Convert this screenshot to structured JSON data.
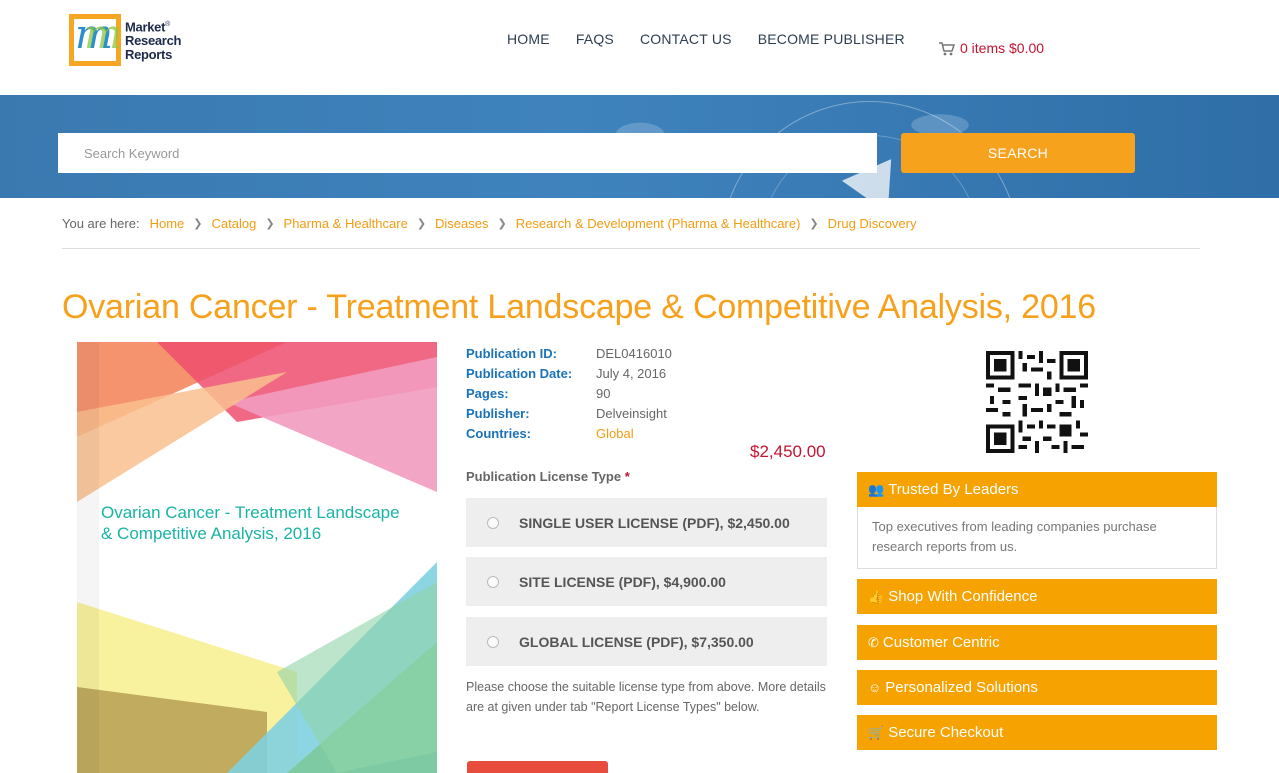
{
  "header": {
    "logo": {
      "line1": "Market",
      "line2": "Research",
      "line3": "Reports",
      "reg": "®"
    },
    "nav": [
      "HOME",
      "FAQS",
      "CONTACT US",
      "BECOME PUBLISHER"
    ],
    "cart": "0 items $0.00"
  },
  "search": {
    "placeholder": "Search Keyword",
    "button": "SEARCH"
  },
  "breadcrumb": {
    "label": "You are here:",
    "items": [
      "Home",
      "Catalog",
      "Pharma & Healthcare",
      "Diseases",
      "Research & Development (Pharma & Healthcare)",
      "Drug Discovery"
    ]
  },
  "title": "Ovarian Cancer - Treatment Landscape & Competitive Analysis, 2016",
  "cover_title": "Ovarian Cancer - Treatment Landscape & Competitive Analysis, 2016",
  "meta": [
    {
      "key": "Publication ID:",
      "value": "DEL0416010"
    },
    {
      "key": "Publication Date:",
      "value": "July 4, 2016"
    },
    {
      "key": "Pages:",
      "value": "90"
    },
    {
      "key": "Publisher:",
      "value": "Delveinsight"
    },
    {
      "key": "Countries:",
      "value": "Global"
    }
  ],
  "price": "$2,450.00",
  "license": {
    "label": "Publication License Type",
    "required": "*",
    "options": [
      "SINGLE USER LICENSE (PDF), $2,450.00",
      "SITE LICENSE (PDF), $4,900.00",
      "GLOBAL LICENSE (PDF), $7,350.00"
    ],
    "note": "Please choose the suitable license type from above. More details are at given under tab \"Report License Types\" below."
  },
  "panels": {
    "trusted": {
      "title": "Trusted By Leaders",
      "body": "Top executives from leading companies purchase research reports from us.",
      "icon": "users-icon"
    },
    "items": [
      {
        "title": "Shop With Confidence",
        "icon": "thumbs-up-icon"
      },
      {
        "title": "Customer Centric",
        "icon": "phone-icon"
      },
      {
        "title": "Personalized Solutions",
        "icon": "smile-icon"
      },
      {
        "title": "Secure Checkout",
        "icon": "cart-icon"
      }
    ]
  },
  "colors": {
    "accent": "#f6a200",
    "title": "#f7a01b",
    "link": "#f39c12",
    "price": "#c41230",
    "meta_key": "#1a73b8",
    "banner": "#3a79b0"
  }
}
